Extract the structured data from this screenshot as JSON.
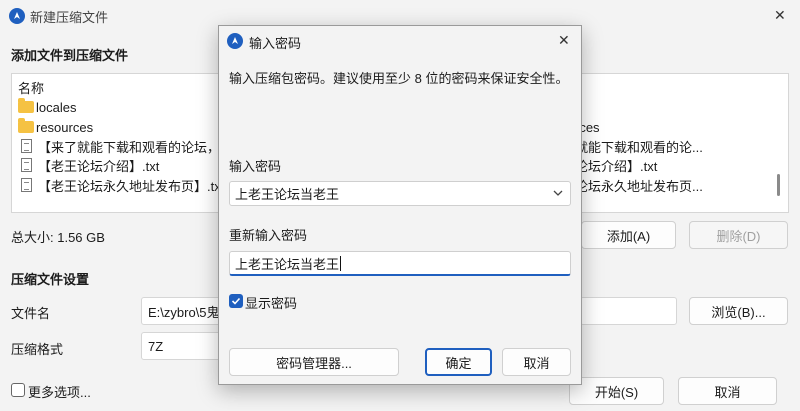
{
  "main": {
    "title": "新建压缩文件",
    "add_section_title": "添加文件到压缩文件",
    "list_header": "名称",
    "left_items": [
      {
        "icon": "folder-icon",
        "name": "locales"
      },
      {
        "icon": "folder-icon",
        "name": "resources"
      },
      {
        "icon": "document-icon",
        "name": "【来了就能下载和观看的论坛，纯"
      },
      {
        "icon": "document-icon",
        "name": "【老王论坛介绍】.txt"
      },
      {
        "icon": "document-icon",
        "name": "【老王论坛永久地址发布页】.txt"
      }
    ],
    "right_items": [
      "s",
      "rces",
      "就能下载和观看的论...",
      "论坛介绍】.txt",
      "论坛永久地址发布页..."
    ],
    "total_size": "总大小: 1.56 GB",
    "add_button": "添加(A)",
    "delete_button": "删除(D)",
    "settings_title": "压缩文件设置",
    "file_name_label": "文件名",
    "file_name_value": "E:\\zybro\\5鬼",
    "browse_button": "浏览(B)...",
    "format_label": "压缩格式",
    "format_value": "7Z",
    "more_options_label": "更多选项...",
    "start_button": "开始(S)",
    "cancel_button": "取消"
  },
  "dialog": {
    "title": "输入密码",
    "description": "输入压缩包密码。建议使用至少 8 位的密码来保证安全性。",
    "password_label": "输入密码",
    "password_value": "上老王论坛当老王",
    "confirm_label": "重新输入密码",
    "confirm_value": "上老王论坛当老王",
    "show_password_label": "显示密码",
    "show_password_checked": true,
    "manager_button": "密码管理器...",
    "ok_button": "确定",
    "cancel_button": "取消"
  },
  "colors": {
    "accent": "#1f5fbf",
    "folder": "#f5c243"
  }
}
